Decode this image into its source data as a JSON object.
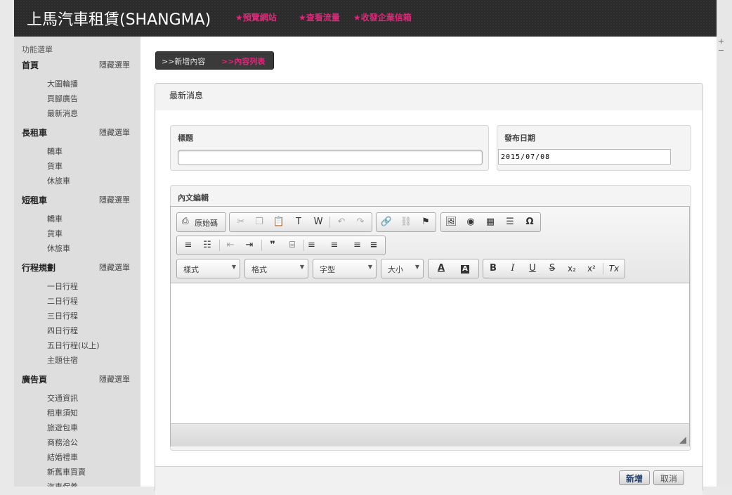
{
  "header": {
    "site_title": "上馬汽車租賃(SHANGMA)",
    "links": [
      "★預覽網站",
      "★查看流量",
      "★收發企業信箱"
    ]
  },
  "sidebar": {
    "menu_title": "功能選單",
    "hide_label": "隱藏選單",
    "sections": [
      {
        "title": "首頁",
        "items": [
          "大圖輪播",
          "頁腳廣告",
          "最新消息"
        ]
      },
      {
        "title": "長租車",
        "items": [
          "轎車",
          "貨車",
          "休旅車"
        ]
      },
      {
        "title": "短租車",
        "items": [
          "轎車",
          "貨車",
          "休旅車"
        ]
      },
      {
        "title": "行程規劃",
        "items": [
          "一日行程",
          "二日行程",
          "三日行程",
          "四日行程",
          "五日行程(以上)",
          "主題住宿"
        ]
      },
      {
        "title": "廣告頁",
        "items": [
          "交通資訊",
          "租車須知",
          "旅遊包車",
          "商務洽公",
          "結婚禮車",
          "新舊車買賣",
          "汽車保養"
        ]
      }
    ]
  },
  "tabs": {
    "add": ">>新增內容",
    "list": ">>內容列表"
  },
  "panel": {
    "title": "最新消息",
    "title_field_label": "標題",
    "title_value": "",
    "date_field_label": "發布日期",
    "date_value": "2015/07/08",
    "content_label": "內文編輯"
  },
  "editor": {
    "source_button": "原始碼",
    "combos": [
      "樣式",
      "格式",
      "字型",
      "大小"
    ],
    "glyphs": {
      "cut": "✂",
      "copy": "❐",
      "paste": "📋",
      "paste_text": "T",
      "paste_word": "W",
      "undo": "↶",
      "redo": "↷",
      "link": "🔗",
      "unlink": "⛓",
      "anchor": "⚑",
      "image": "🖼",
      "flash": "◉",
      "table": "▦",
      "hline": "☰",
      "special_char": "Ω",
      "ol": "≡",
      "ul": "☷",
      "outdent": "⇤",
      "indent": "⇥",
      "blockquote": "❞",
      "div": "⌸",
      "align_left": "≡",
      "align_center": "≡",
      "align_right": "≡",
      "justify": "≡",
      "text_color": "A",
      "bg_color": "A",
      "bold": "B",
      "italic": "I",
      "underline": "U",
      "strike": "S",
      "subscript": "x₂",
      "superscript": "x²",
      "remove_format": "Tx"
    }
  },
  "buttons": {
    "submit": "新增",
    "cancel": "取消"
  },
  "side_controls": "+ −",
  "colors": {
    "accent": "#e0267a",
    "header_bg": "#2b2b2b",
    "sidebar_bg": "#dedede"
  }
}
